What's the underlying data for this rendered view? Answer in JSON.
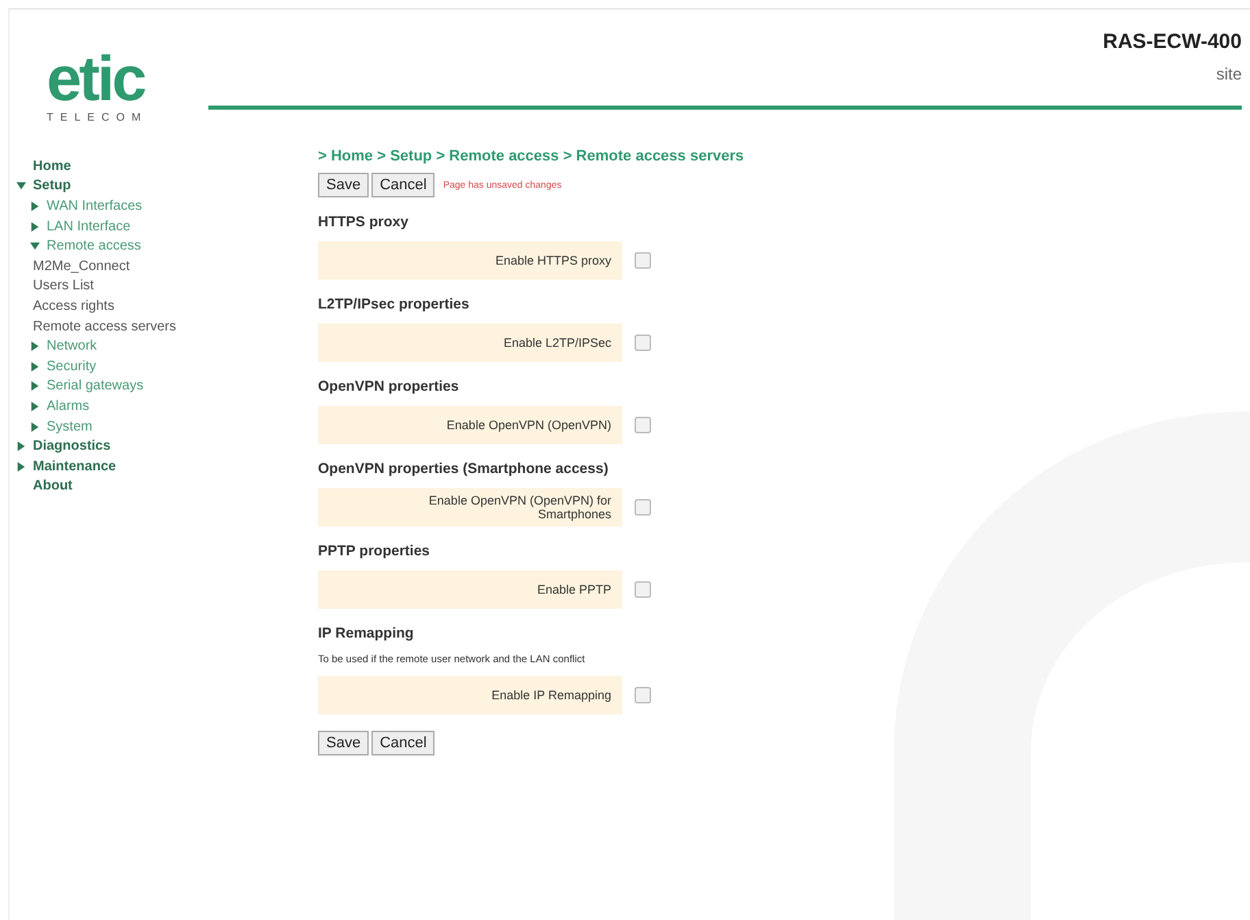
{
  "header": {
    "logo": {
      "name": "etic",
      "tagline": "TELECOM"
    },
    "device": "RAS-ECW-400",
    "site": "site"
  },
  "sidebar": {
    "items": [
      {
        "label": "Home"
      },
      {
        "label": "Setup",
        "expanded": true,
        "children": [
          {
            "label": "WAN Interfaces",
            "expanded": false
          },
          {
            "label": "LAN Interface",
            "expanded": false
          },
          {
            "label": "Remote access",
            "expanded": true,
            "children": [
              {
                "label": "M2Me_Connect"
              },
              {
                "label": "Users List"
              },
              {
                "label": "Access rights"
              },
              {
                "label": "Remote access servers"
              }
            ]
          },
          {
            "label": "Network",
            "expanded": false
          },
          {
            "label": "Security",
            "expanded": false
          },
          {
            "label": "Serial gateways",
            "expanded": false
          },
          {
            "label": "Alarms",
            "expanded": false
          },
          {
            "label": "System",
            "expanded": false
          }
        ]
      },
      {
        "label": "Diagnostics",
        "expanded": false
      },
      {
        "label": "Maintenance",
        "expanded": false
      },
      {
        "label": "About"
      }
    ]
  },
  "breadcrumb": "> Home > Setup > Remote access > Remote access servers",
  "top_buttons": [
    "Save",
    "Cancel"
  ],
  "unsaved_notice": "Page has unsaved changes",
  "sections": [
    {
      "title": "HTTPS proxy",
      "option": {
        "label": "Enable HTTPS proxy",
        "checked": false
      }
    },
    {
      "title": "L2TP/IPsec properties",
      "option": {
        "label": "Enable L2TP/IPSec",
        "checked": false
      }
    },
    {
      "title": "OpenVPN properties",
      "option": {
        "label": "Enable OpenVPN (OpenVPN)",
        "checked": false
      }
    },
    {
      "title": "OpenVPN properties (Smartphone access)",
      "option": {
        "label": "Enable OpenVPN (OpenVPN) for Smartphones",
        "checked": false
      }
    },
    {
      "title": "PPTP properties",
      "option": {
        "label": "Enable PPTP",
        "checked": false
      }
    },
    {
      "title": "IP Remapping",
      "note": "To be used if the remote user network and the LAN conflict",
      "option": {
        "label": "Enable IP Remapping",
        "checked": false
      }
    }
  ],
  "bottom_buttons": [
    "Save",
    "Cancel"
  ]
}
